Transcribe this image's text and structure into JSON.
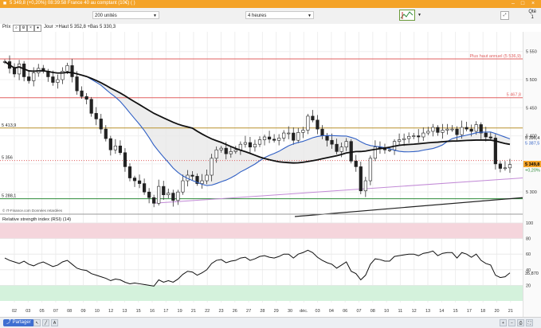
{
  "window": {
    "title_price": "5 349,8",
    "title_change": "(+0,20%)",
    "title_rest": "08:39:58 France 40 au comptant (10€) ( )"
  },
  "toolbar": {
    "units_value": "200 unités",
    "timeframe_value": "4 heures",
    "qty_label": "Qté",
    "qty_value": "1"
  },
  "chart_header": {
    "panel_label": "Prix",
    "ohlc_text": "Jour :+Haut 5 352,8 +Bas 5 330,3"
  },
  "footer": {
    "share_label": "Partager",
    "copyright": "© IT-Finance.com Données retardées"
  },
  "colors": {
    "accent": "#f4a328",
    "blue_ma": "#2f5fc4",
    "red_lines": "#e06060",
    "green_line": "#2e8b3a",
    "violet_trend": "#c28ad6",
    "rsi_top_zone": "#f5d5dc",
    "rsi_bottom_zone": "#d4f2dc"
  },
  "chart_data": [
    {
      "type": "candlestick",
      "panel": "price",
      "ylim": [
        5262,
        5585
      ],
      "y_ticks": [
        "5 550",
        "5 500",
        "5 450",
        "5 400",
        "5 350",
        "5 300"
      ],
      "x_labels": [
        "02",
        "03",
        "05",
        "07",
        "08",
        "09",
        "10",
        "12",
        "13",
        "15",
        "16",
        "17",
        "19",
        "21",
        "22",
        "23",
        "26",
        "27",
        "28",
        "29",
        "30",
        "déc.",
        "03",
        "04",
        "06",
        "07",
        "08",
        "10",
        "11",
        "12",
        "13",
        "14",
        "15",
        "17",
        "18",
        "20",
        "21"
      ],
      "close": [
        5532,
        5520,
        5510,
        5528,
        5505,
        5498,
        5512,
        5520,
        5515,
        5505,
        5495,
        5500,
        5515,
        5525,
        5505,
        5480,
        5470,
        5465,
        5440,
        5430,
        5412,
        5395,
        5375,
        5382,
        5370,
        5345,
        5325,
        5320,
        5315,
        5300,
        5290,
        5280,
        5310,
        5295,
        5298,
        5285,
        5300,
        5320,
        5330,
        5328,
        5315,
        5320,
        5330,
        5360,
        5375,
        5378,
        5368,
        5372,
        5375,
        5385,
        5388,
        5380,
        5385,
        5393,
        5398,
        5394,
        5392,
        5396,
        5405,
        5405,
        5392,
        5406,
        5410,
        5435,
        5428,
        5412,
        5400,
        5392,
        5385,
        5372,
        5380,
        5390,
        5355,
        5345,
        5302,
        5320,
        5360,
        5380,
        5378,
        5375,
        5375,
        5390,
        5393,
        5395,
        5399,
        5400,
        5398,
        5405,
        5408,
        5415,
        5406,
        5410,
        5412,
        5412,
        5402,
        5415,
        5412,
        5408,
        5420,
        5405,
        5398,
        5396,
        5350,
        5342,
        5343,
        5349
      ],
      "high_annual": {
        "label": "Plus haut annuel (5 536,9)",
        "value": 5536.9
      },
      "levels": [
        {
          "label": "5 467,8",
          "value": 5467.8,
          "color": "#e06060",
          "side": "right"
        },
        {
          "label": "5 413,9",
          "value": 5413.9,
          "color": "#b8912d",
          "side": "left"
        },
        {
          "label": "5 288,1",
          "value": 5288.1,
          "color": "#2e8b3a",
          "side": "left"
        },
        {
          "label": "5 356",
          "value": 5356,
          "color": "#e06060",
          "side": "left",
          "dotted": true
        }
      ],
      "tags": [
        {
          "label": "5 396,4",
          "value": 5396.4,
          "color": "#222222"
        },
        {
          "label": "5 387,5",
          "value": 5387.5,
          "color": "#2f5fc4"
        },
        {
          "label": "5 349,8",
          "value": 5349.8,
          "color": "#222222",
          "highlight": true
        },
        {
          "label": "+0,20%",
          "value": 5339,
          "color": "#2e8b3a"
        }
      ]
    },
    {
      "type": "line",
      "panel": "rsi",
      "title": "Relative strength index (RSI) (14)",
      "ylim": [
        0,
        100
      ],
      "y_ticks": [
        100,
        80,
        60,
        40,
        20
      ],
      "zones": [
        [
          80,
          100
        ],
        [
          0,
          20
        ]
      ],
      "last_label": "35,870",
      "values": [
        55,
        52,
        50,
        48,
        51,
        47,
        45,
        48,
        50,
        47,
        44,
        46,
        50,
        52,
        47,
        42,
        40,
        39,
        35,
        33,
        31,
        29,
        26,
        28,
        27,
        24,
        22,
        23,
        22,
        21,
        20,
        19,
        27,
        24,
        26,
        24,
        28,
        34,
        38,
        37,
        33,
        36,
        40,
        48,
        52,
        53,
        49,
        51,
        52,
        55,
        56,
        52,
        54,
        57,
        58,
        56,
        55,
        57,
        60,
        60,
        55,
        60,
        62,
        65,
        62,
        56,
        52,
        49,
        47,
        42,
        46,
        50,
        38,
        35,
        27,
        33,
        47,
        54,
        53,
        51,
        51,
        57,
        58,
        59,
        60,
        60,
        58,
        61,
        62,
        64,
        58,
        61,
        62,
        62,
        55,
        62,
        60,
        56,
        60,
        52,
        48,
        46,
        33,
        30,
        31,
        36
      ]
    }
  ]
}
